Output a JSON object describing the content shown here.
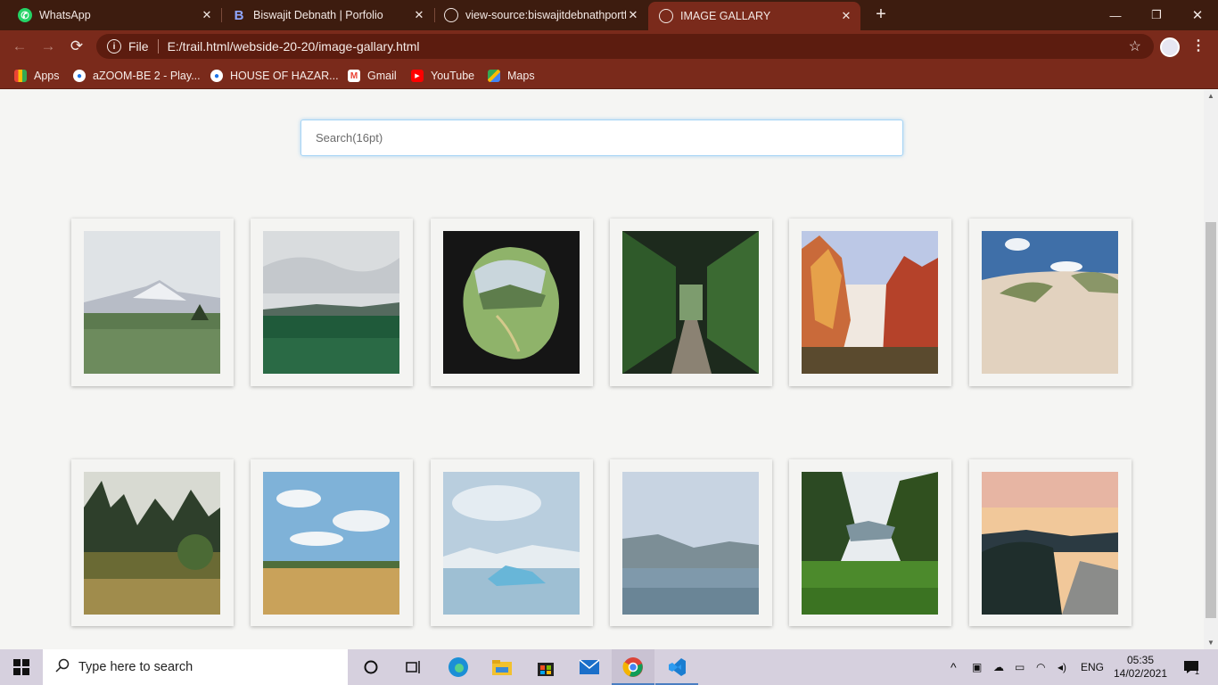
{
  "browser": {
    "tabs": [
      {
        "title": "WhatsApp",
        "icon": "whatsapp-icon",
        "active": false
      },
      {
        "title": "Biswajit Debnath | Porfolio",
        "icon": "b-icon",
        "active": false
      },
      {
        "title": "view-source:biswajitdebnathportfolio",
        "icon": "globe-icon",
        "active": false
      },
      {
        "title": "IMAGE GALLARY",
        "icon": "globe-icon",
        "active": true
      }
    ],
    "new_tab": "+",
    "file_label": "File",
    "url": "E:/trail.html/webside-20-20/image-gallary.html",
    "bookmarks": [
      "Apps",
      "aZOOM-BE 2 - Play...",
      "HOUSE OF HAZAR...",
      "Gmail",
      "YouTube",
      "Maps"
    ]
  },
  "page": {
    "search_placeholder": "Search(16pt)",
    "gallery": [
      {
        "name": "photo-mountain-meadow",
        "scene": "mountain-meadow"
      },
      {
        "name": "photo-green-field",
        "scene": "green-field"
      },
      {
        "name": "photo-cave-valley",
        "scene": "cave-valley"
      },
      {
        "name": "photo-forest-path",
        "scene": "forest-path"
      },
      {
        "name": "photo-red-canyon",
        "scene": "red-canyon"
      },
      {
        "name": "photo-sand-dunes",
        "scene": "sand-dunes"
      },
      {
        "name": "photo-pine-garden",
        "scene": "pine-garden"
      },
      {
        "name": "photo-hay-field",
        "scene": "hay-field"
      },
      {
        "name": "photo-iceberg-lake",
        "scene": "iceberg-lake"
      },
      {
        "name": "photo-misty-lake",
        "scene": "misty-lake"
      },
      {
        "name": "photo-jungle-valley",
        "scene": "jungle-valley"
      },
      {
        "name": "photo-sunset-coast",
        "scene": "sunset-coast"
      }
    ]
  },
  "taskbar": {
    "search_text": "Type here to search",
    "language": "ENG",
    "time": "05:35",
    "date": "14/02/2021",
    "notification_count": "1"
  },
  "colors": {
    "tabbar": "#3d1c0f",
    "toolbar": "#7a2a1b",
    "page_bg": "#f5f5f3",
    "taskbar": "#d6d0de"
  }
}
